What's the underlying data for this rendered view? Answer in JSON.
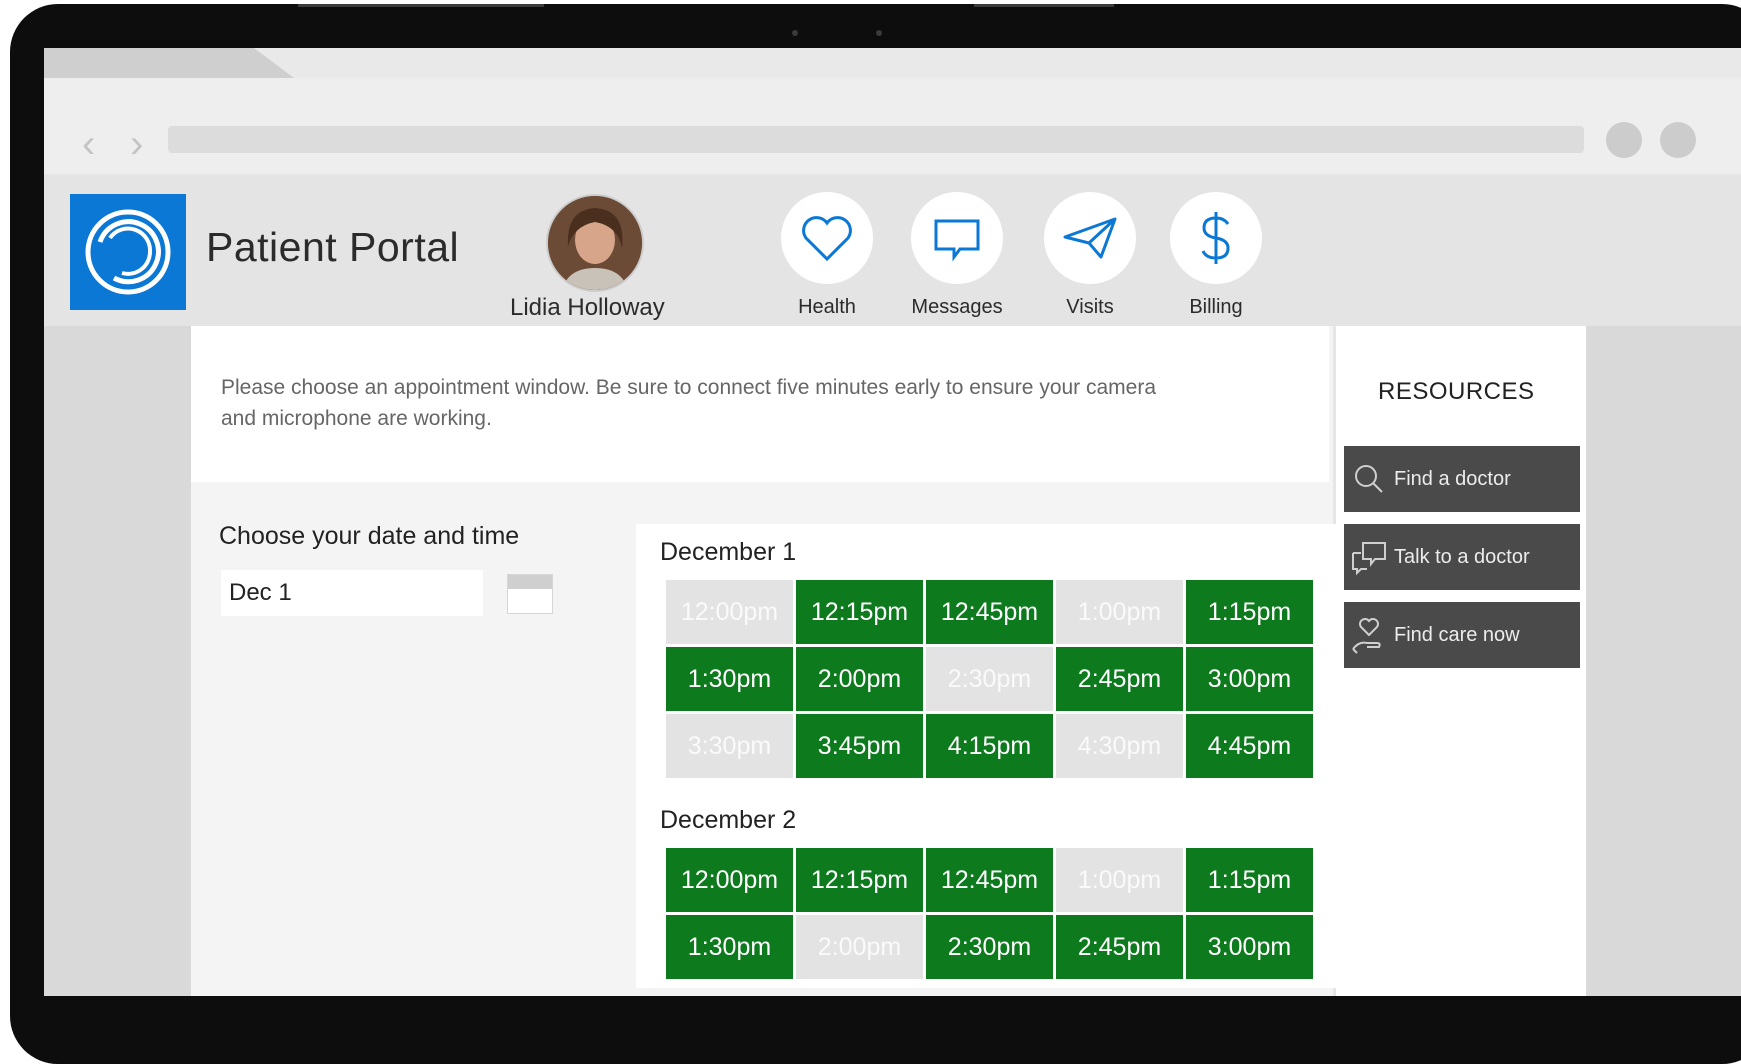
{
  "app": {
    "title": "Patient Portal",
    "user_name": "Lidia Holloway"
  },
  "nav": [
    {
      "label": "Health",
      "icon": "heart-icon"
    },
    {
      "label": "Messages",
      "icon": "message-icon"
    },
    {
      "label": "Visits",
      "icon": "send-icon"
    },
    {
      "label": "Billing",
      "icon": "dollar-icon"
    }
  ],
  "instructions": "Please choose an appointment window. Be sure to connect five minutes early to ensure your camera and microphone are working.",
  "date_picker": {
    "label": "Choose your date and time",
    "value": "Dec 1"
  },
  "days": [
    {
      "title": "December 1",
      "slots": [
        {
          "time": "12:00pm",
          "available": false
        },
        {
          "time": "12:15pm",
          "available": true
        },
        {
          "time": "12:45pm",
          "available": true
        },
        {
          "time": "1:00pm",
          "available": false
        },
        {
          "time": "1:15pm",
          "available": true
        },
        {
          "time": "1:30pm",
          "available": true
        },
        {
          "time": "2:00pm",
          "available": true
        },
        {
          "time": "2:30pm",
          "available": false
        },
        {
          "time": "2:45pm",
          "available": true
        },
        {
          "time": "3:00pm",
          "available": true
        },
        {
          "time": "3:30pm",
          "available": false
        },
        {
          "time": "3:45pm",
          "available": true
        },
        {
          "time": "4:15pm",
          "available": true
        },
        {
          "time": "4:30pm",
          "available": false
        },
        {
          "time": "4:45pm",
          "available": true
        }
      ]
    },
    {
      "title": "December 2",
      "slots": [
        {
          "time": "12:00pm",
          "available": true
        },
        {
          "time": "12:15pm",
          "available": true
        },
        {
          "time": "12:45pm",
          "available": true
        },
        {
          "time": "1:00pm",
          "available": false
        },
        {
          "time": "1:15pm",
          "available": true
        },
        {
          "time": "1:30pm",
          "available": true
        },
        {
          "time": "2:00pm",
          "available": false
        },
        {
          "time": "2:30pm",
          "available": true
        },
        {
          "time": "2:45pm",
          "available": true
        },
        {
          "time": "3:00pm",
          "available": true
        }
      ]
    }
  ],
  "resources": {
    "title": "RESOURCES",
    "items": [
      {
        "label": "Find a doctor",
        "icon": "search-icon"
      },
      {
        "label": "Talk to a doctor",
        "icon": "chat-bubbles-icon"
      },
      {
        "label": "Find care now",
        "icon": "heart-hand-icon"
      }
    ]
  },
  "colors": {
    "brand": "#0a78d4",
    "slot_available": "#0e7a1e",
    "slot_unavailable": "#e3e3e3",
    "resource_button": "#4a4a4a"
  }
}
